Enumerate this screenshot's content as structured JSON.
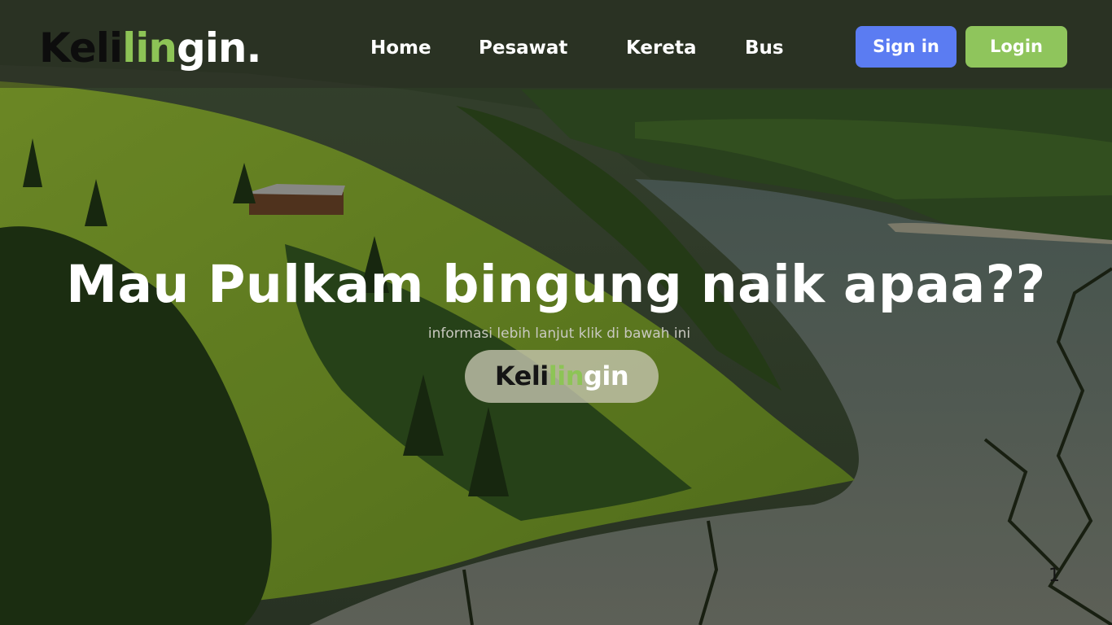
{
  "brand": {
    "logo_part1": "Keli",
    "logo_part2": "lin",
    "logo_part3": "gin.",
    "colors": {
      "dark": "#0d0d0d",
      "accent": "#8dc456",
      "light": "#ffffff"
    }
  },
  "nav": {
    "home": "Home",
    "pesawat": "Pesawat",
    "kereta": "Kereta",
    "bus": "Bus"
  },
  "auth": {
    "signin_label": "Sign in",
    "signin_color": "#5b7cf2",
    "login_label": "Login",
    "login_color": "#8fc55c"
  },
  "hero": {
    "headline": "Mau Pulkam bingung naik apaa??",
    "subline": "informasi lebih lanjut klik di bawah ini",
    "cta_part1": "Keli",
    "cta_part2": "lin",
    "cta_part3": "gin",
    "background": "mountain lake landscape with green hills and forest"
  },
  "page_indicator": "1"
}
